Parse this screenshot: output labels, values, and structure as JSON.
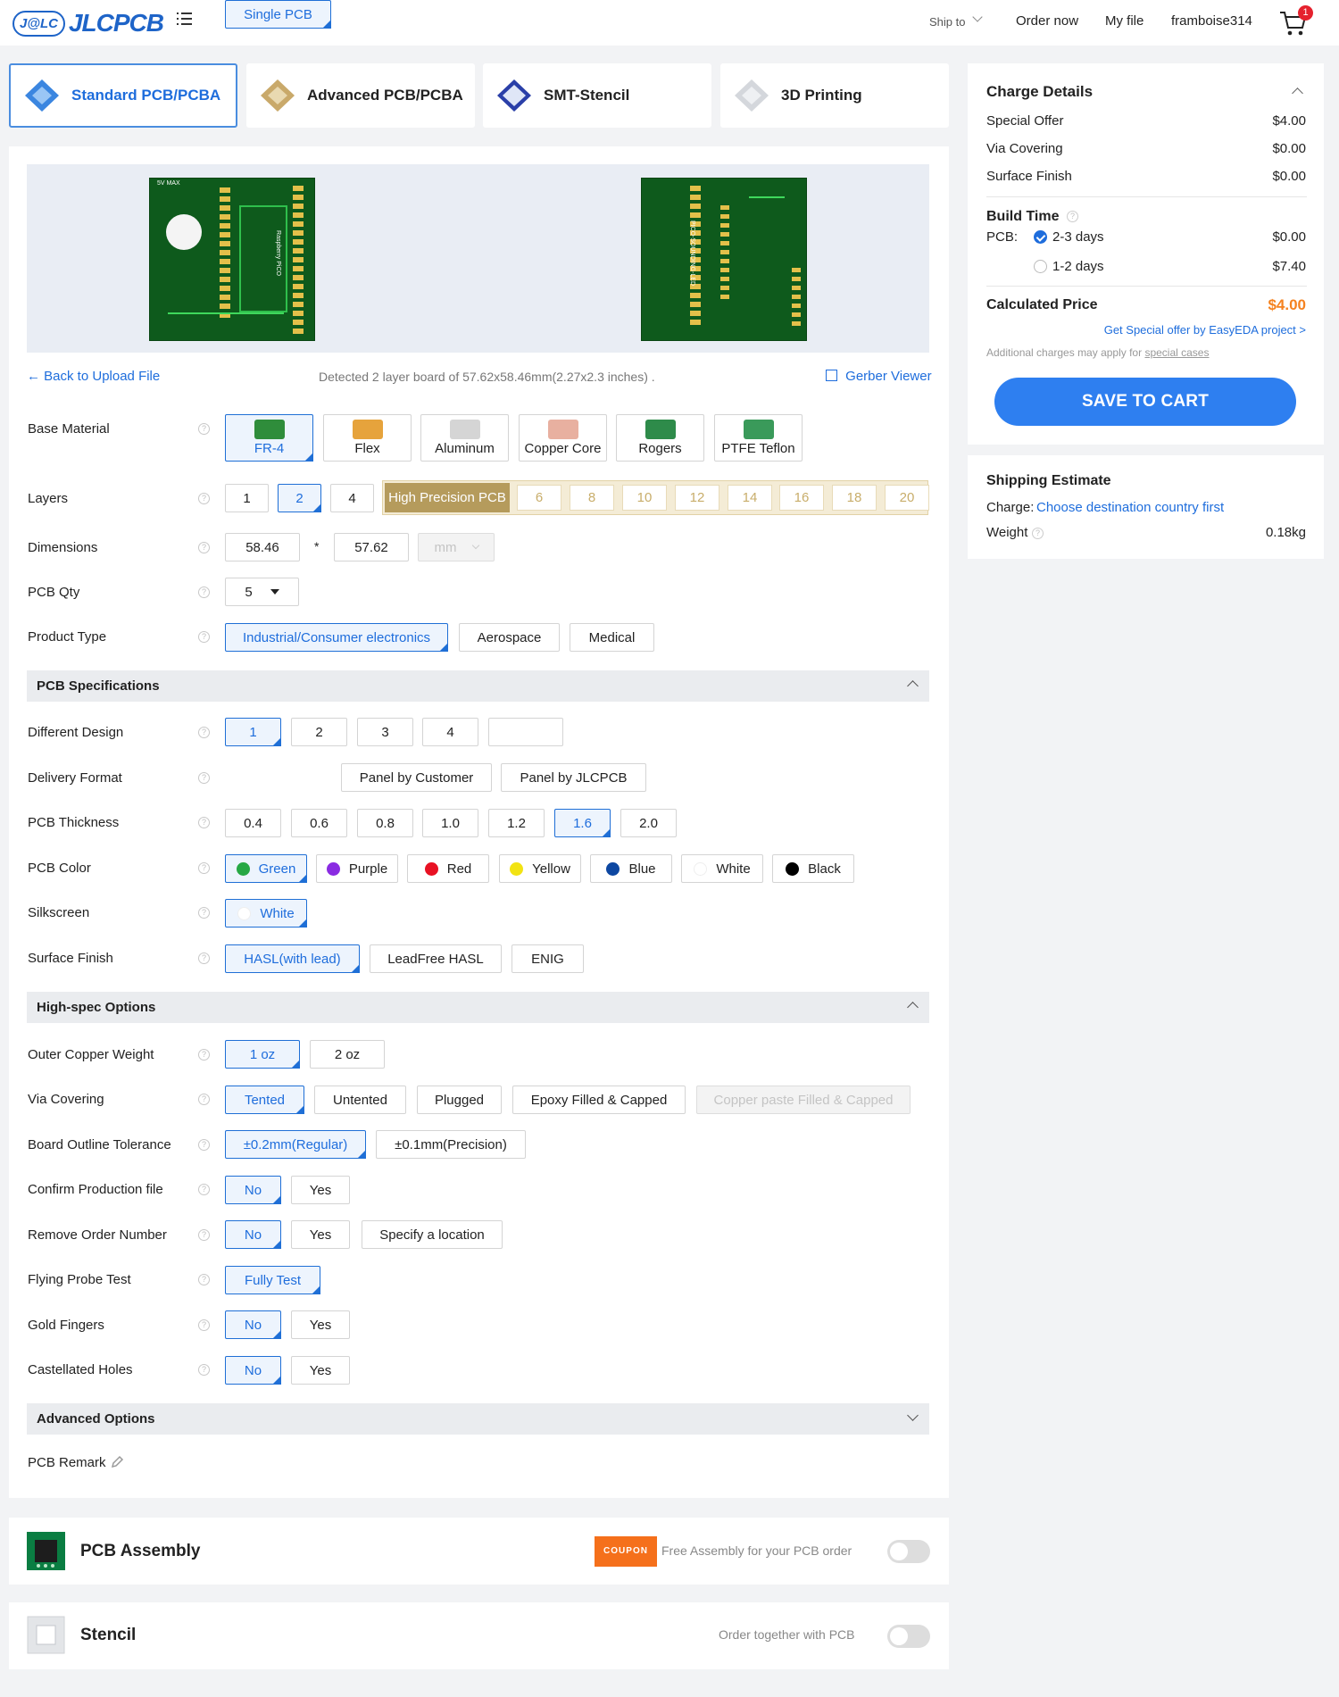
{
  "header": {
    "logo_mark": "J@LC",
    "logo_text": "JLCPCB",
    "ship_to": "Ship to",
    "order_now": "Order now",
    "my_file": "My file",
    "username": "framboise314",
    "cart_count": "1"
  },
  "tabs": [
    {
      "label": "Standard PCB/PCBA"
    },
    {
      "label": "Advanced PCB/PCBA"
    },
    {
      "label": "SMT-Stencil"
    },
    {
      "label": "3D Printing"
    }
  ],
  "upload": {
    "back_label": "Back to Upload File",
    "detected": "Detected 2 layer board of 57.62x58.46mm(2.27x2.3 inches) .",
    "gerber_viewer": "Gerber Viewer",
    "board_text": "5V MAX",
    "board_brand": "Raspberry PiCO",
    "back_text": "PICO-SOUNDING-LED",
    "back_url": "www.framboise314.fr"
  },
  "form": {
    "base_material": {
      "label": "Base Material",
      "options": [
        "FR-4",
        "Flex",
        "Aluminum",
        "Copper Core",
        "Rogers",
        "PTFE Teflon"
      ],
      "selected": "FR-4"
    },
    "layers": {
      "label": "Layers",
      "options": [
        "1",
        "2",
        "4"
      ],
      "selected": "2",
      "high_precision_label": "High Precision PCB",
      "high_precision_options": [
        "6",
        "8",
        "10",
        "12",
        "14",
        "16",
        "18",
        "20"
      ]
    },
    "dimensions": {
      "label": "Dimensions",
      "width": "58.46",
      "times": "*",
      "height": "57.62",
      "unit": "mm"
    },
    "qty": {
      "label": "PCB Qty",
      "value": "5"
    },
    "product_type": {
      "label": "Product Type",
      "options": [
        "Industrial/Consumer electronics",
        "Aerospace",
        "Medical"
      ],
      "selected": "Industrial/Consumer electronics"
    }
  },
  "specs": {
    "title": "PCB Specifications",
    "different_design": {
      "label": "Different Design",
      "options": [
        "1",
        "2",
        "3",
        "4"
      ],
      "selected": "1"
    },
    "delivery_format": {
      "label": "Delivery Format",
      "options": [
        "Single PCB",
        "Panel by Customer",
        "Panel by JLCPCB"
      ],
      "selected": "Single PCB"
    },
    "thickness": {
      "label": "PCB Thickness",
      "options": [
        "0.4",
        "0.6",
        "0.8",
        "1.0",
        "1.2",
        "1.6",
        "2.0"
      ],
      "selected": "1.6"
    },
    "color": {
      "label": "PCB Color",
      "options": [
        {
          "name": "Green",
          "hex": "#27a844"
        },
        {
          "name": "Purple",
          "hex": "#8a2be2"
        },
        {
          "name": "Red",
          "hex": "#e81123"
        },
        {
          "name": "Yellow",
          "hex": "#f2e313"
        },
        {
          "name": "Blue",
          "hex": "#0d47a1"
        },
        {
          "name": "White",
          "hex": "#ffffff"
        },
        {
          "name": "Black",
          "hex": "#000000"
        }
      ],
      "selected": "Green"
    },
    "silkscreen": {
      "label": "Silkscreen",
      "options": [
        "White"
      ],
      "selected": "White"
    },
    "surface_finish": {
      "label": "Surface Finish",
      "options": [
        "HASL(with lead)",
        "LeadFree HASL",
        "ENIG"
      ],
      "selected": "HASL(with lead)"
    }
  },
  "highspec": {
    "title": "High-spec Options",
    "copper_weight": {
      "label": "Outer Copper Weight",
      "options": [
        "1 oz",
        "2 oz"
      ],
      "selected": "1 oz"
    },
    "via_covering": {
      "label": "Via Covering",
      "options": [
        "Tented",
        "Untented",
        "Plugged",
        "Epoxy Filled & Capped",
        "Copper paste Filled & Capped"
      ],
      "selected": "Tented"
    },
    "outline_tolerance": {
      "label": "Board Outline Tolerance",
      "options": [
        "±0.2mm(Regular)",
        "±0.1mm(Precision)"
      ],
      "selected": "±0.2mm(Regular)"
    },
    "confirm_file": {
      "label": "Confirm Production file",
      "options": [
        "No",
        "Yes"
      ],
      "selected": "No"
    },
    "remove_order_number": {
      "label": "Remove Order Number",
      "options": [
        "No",
        "Yes",
        "Specify a location"
      ],
      "selected": "No"
    },
    "flying_probe": {
      "label": "Flying Probe Test",
      "options": [
        "Fully Test"
      ],
      "selected": "Fully Test"
    },
    "gold_fingers": {
      "label": "Gold Fingers",
      "options": [
        "No",
        "Yes"
      ],
      "selected": "No"
    },
    "castellated": {
      "label": "Castellated Holes",
      "options": [
        "No",
        "Yes"
      ],
      "selected": "No"
    }
  },
  "advanced": {
    "title": "Advanced Options",
    "remark_label": "PCB Remark"
  },
  "assembly": {
    "title": "PCB Assembly",
    "coupon": "COUPON",
    "promo": "Free Assembly for your PCB order"
  },
  "stencil": {
    "title": "Stencil",
    "promo": "Order together with PCB"
  },
  "charges": {
    "title": "Charge Details",
    "rows": [
      {
        "label": "Special Offer",
        "value": "$4.00"
      },
      {
        "label": "Via Covering",
        "value": "$0.00"
      },
      {
        "label": "Surface Finish",
        "value": "$0.00"
      }
    ],
    "build_time_title": "Build Time",
    "pcb_label": "PCB:",
    "build_options": [
      {
        "label": "2-3 days",
        "value": "$0.00"
      },
      {
        "label": "1-2 days",
        "value": "$7.40"
      }
    ],
    "calculated_label": "Calculated Price",
    "calculated_value": "$4.00",
    "special_offer_link": "Get Special offer by EasyEDA project >",
    "note_prefix": "Additional charges may apply for",
    "note_link": "special cases",
    "save_button": "SAVE TO CART"
  },
  "shipping": {
    "title": "Shipping Estimate",
    "charge_label": "Charge:",
    "charge_link": "Choose destination country first",
    "weight_label": "Weight",
    "weight_value": "0.18kg"
  },
  "colors": {
    "accent": "#1e6ddc",
    "button": "#2e7ff0",
    "price": "#f5821f",
    "gold": "#b59b5c"
  }
}
